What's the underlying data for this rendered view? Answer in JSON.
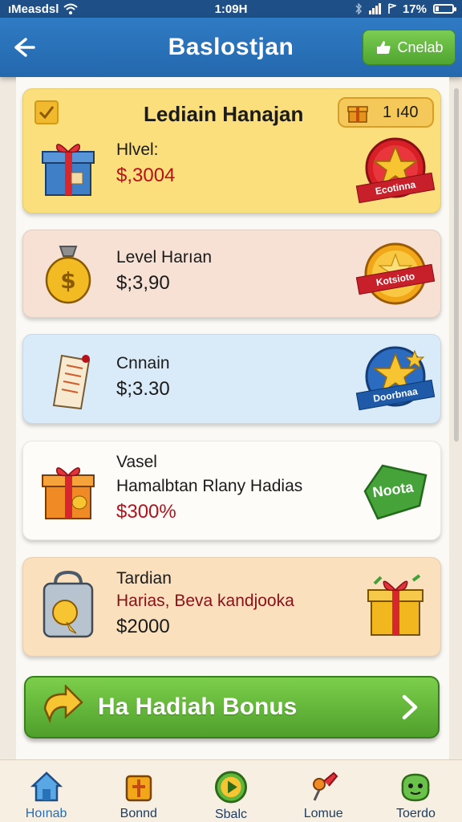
{
  "status_bar": {
    "carrier": "ıMeasdsl",
    "time": "1:09H",
    "battery": "17%"
  },
  "header": {
    "title": "Baslostjan",
    "check_label": "Cnelab"
  },
  "cards": [
    {
      "heading": "Lediain Hanajan",
      "counter": "1 ı40",
      "line1": "Hlvel:",
      "price": "$,3004",
      "badge": "Ecotinna",
      "bg": "#fbdf7c"
    },
    {
      "line1": "Level Harıan",
      "price": "$;3,90",
      "badge": "Kotsioto",
      "bg": "#f6e1d4"
    },
    {
      "line1": "Cnnain",
      "price": "$;3.30",
      "badge": "Doorbnaa",
      "bg": "#d9ebf8"
    },
    {
      "line1": "Vasel",
      "line2": "Hamalbtan Rlany Hadias",
      "price": "$300%",
      "badge": "Noota",
      "bg": "#fdfcf8"
    },
    {
      "line1": "Tardian",
      "line2": "Harias, Beva kandjooka",
      "price": "$2000",
      "bg": "#fbe0bd"
    }
  ],
  "bonus_button": {
    "label": "Ha Hadiah Bonus"
  },
  "bottom_nav": [
    {
      "label": "Hoınab",
      "icon": "home-icon",
      "active": true
    },
    {
      "label": "Bonnd",
      "icon": "bonus-box-icon"
    },
    {
      "label": "Sbalc",
      "icon": "play-icon"
    },
    {
      "label": "Lomue",
      "icon": "pin-icon"
    },
    {
      "label": "Toerdo",
      "icon": "character-icon"
    }
  ],
  "colors": {
    "header_blue": "#2a72b8",
    "accent_green": "#5cb337",
    "price_red": "#b5121b"
  }
}
